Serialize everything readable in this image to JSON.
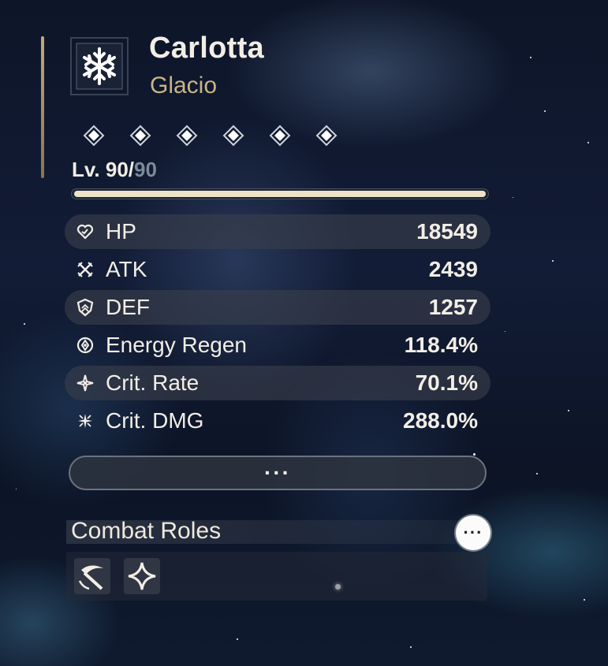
{
  "character": {
    "name": "Carlotta",
    "element": "Glacio",
    "element_icon": "snowflake-icon",
    "sequence_nodes": 6
  },
  "level": {
    "current": "Lv. 90/",
    "max": "90",
    "progress": 1.0
  },
  "stats": [
    {
      "icon": "hp-heart-icon",
      "label": "HP",
      "value": "18549"
    },
    {
      "icon": "atk-crossed-swords-icon",
      "label": "ATK",
      "value": "2439"
    },
    {
      "icon": "def-shield-icon",
      "label": "DEF",
      "value": "1257"
    },
    {
      "icon": "energy-regen-icon",
      "label": "Energy Regen",
      "value": "118.4%"
    },
    {
      "icon": "crit-rate-star-icon",
      "label": "Crit. Rate",
      "value": "70.1%"
    },
    {
      "icon": "crit-dmg-burst-icon",
      "label": "Crit. DMG",
      "value": "288.0%"
    }
  ],
  "more_button": {
    "label": "···"
  },
  "combat_roles": {
    "title": "Combat Roles",
    "info_button": "···",
    "roles": [
      "scythe-slash-icon",
      "four-point-star-icon"
    ]
  },
  "colors": {
    "accent_gold": "#c9b487",
    "text_primary": "#f2eee6",
    "level_fill": "#ece3c8"
  }
}
